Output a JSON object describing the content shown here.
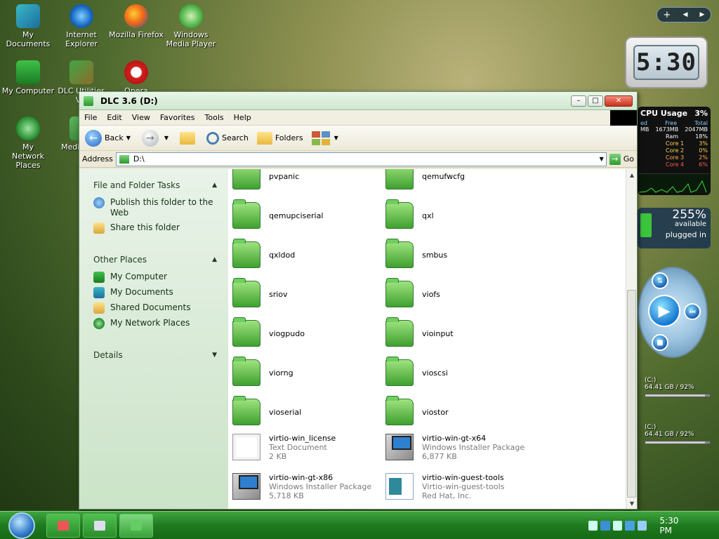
{
  "desktop": {
    "icons": [
      {
        "label": "My Documents"
      },
      {
        "label": "Internet Explorer"
      },
      {
        "label": "Mozilla Firefox"
      },
      {
        "label": "Windows Media Player"
      },
      {
        "label": "My Computer"
      },
      {
        "label": "DLC Utilities V..."
      },
      {
        "label": "Opera"
      },
      {
        "label": "My Network Places"
      },
      {
        "label": "Medi... 2..."
      }
    ]
  },
  "gadgets": {
    "top_controls": {
      "add": "+",
      "prev": "◀",
      "next": "▶"
    },
    "clock_time": "5:30",
    "cpu": {
      "title": "CPU Usage",
      "percent": "3%",
      "headers": [
        "ed",
        "Free",
        "Total"
      ],
      "mem_row": [
        "MB",
        "1673MB",
        "2047MB"
      ],
      "rows": [
        {
          "name": "Ram",
          "value": "18%"
        },
        {
          "name": "Core 1",
          "value": "3%"
        },
        {
          "name": "Core 2",
          "value": "0%"
        },
        {
          "name": "Core 3",
          "value": "2%"
        },
        {
          "name": "Core 4",
          "value": "6%"
        }
      ]
    },
    "battery": {
      "percent": "255%",
      "available": "available",
      "status": "plugged in"
    },
    "drives": [
      {
        "label": "(C:)",
        "info": "64.41 GB / 92%",
        "used_fraction": 0.92
      },
      {
        "label": "(C:)",
        "info": "64.41 GB / 92%",
        "used_fraction": 0.92
      }
    ]
  },
  "window": {
    "title": "DLC 3.6 (D:)",
    "menu": [
      "File",
      "Edit",
      "View",
      "Favorites",
      "Tools",
      "Help"
    ],
    "toolbar": {
      "back": "Back",
      "search": "Search",
      "folders": "Folders"
    },
    "address": {
      "label": "Address",
      "value": "D:\\",
      "go": "Go"
    },
    "taskpane": {
      "file_tasks": {
        "title": "File and Folder Tasks",
        "items": [
          "Publish this folder to the Web",
          "Share this folder"
        ]
      },
      "other_places": {
        "title": "Other Places",
        "items": [
          "My Computer",
          "My Documents",
          "Shared Documents",
          "My Network Places"
        ]
      },
      "details": {
        "title": "Details"
      }
    },
    "files": [
      {
        "name": "pvpanic",
        "type": "folder"
      },
      {
        "name": "qemufwcfg",
        "type": "folder"
      },
      {
        "name": "qemupciserial",
        "type": "folder"
      },
      {
        "name": "qxl",
        "type": "folder"
      },
      {
        "name": "qxldod",
        "type": "folder"
      },
      {
        "name": "smbus",
        "type": "folder"
      },
      {
        "name": "sriov",
        "type": "folder"
      },
      {
        "name": "viofs",
        "type": "folder"
      },
      {
        "name": "viogpudo",
        "type": "folder"
      },
      {
        "name": "vioinput",
        "type": "folder"
      },
      {
        "name": "viorng",
        "type": "folder"
      },
      {
        "name": "vioscsi",
        "type": "folder"
      },
      {
        "name": "vioserial",
        "type": "folder"
      },
      {
        "name": "viostor",
        "type": "folder"
      },
      {
        "name": "virtio-win_license",
        "type": "txt",
        "line2": "Text Document",
        "line3": "2 KB"
      },
      {
        "name": "virtio-win-gt-x64",
        "type": "msi",
        "line2": "Windows Installer Package",
        "line3": "6,877 KB"
      },
      {
        "name": "virtio-win-gt-x86",
        "type": "msi",
        "line2": "Windows Installer Package",
        "line3": "5,718 KB"
      },
      {
        "name": "virtio-win-guest-tools",
        "type": "app",
        "line2": "Virtio-win-guest-tools",
        "line3": "Red Hat, Inc."
      }
    ]
  },
  "taskbar": {
    "time": "5:30 PM"
  }
}
